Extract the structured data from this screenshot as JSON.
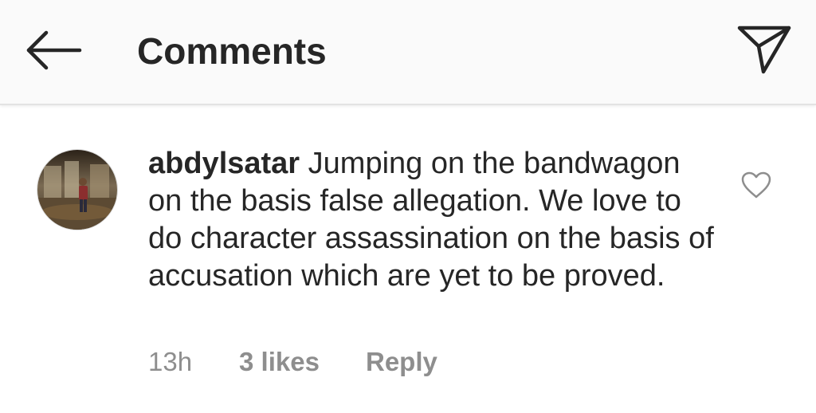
{
  "header": {
    "title": "Comments",
    "back_icon": "arrow-left-icon",
    "send_icon": "paper-plane-icon"
  },
  "comment": {
    "username": "abdylsatar",
    "text": "Jumping on the bandwagon on the basis false allegation. We love to do character assassination on the basis of accusation which are yet to be proved.",
    "time": "13h",
    "likes": "3 likes",
    "reply_label": "Reply",
    "like_icon": "heart-outline-icon"
  },
  "colors": {
    "text": "#262626",
    "secondary_text": "#8e8e8e",
    "header_bg": "#fafafa"
  }
}
